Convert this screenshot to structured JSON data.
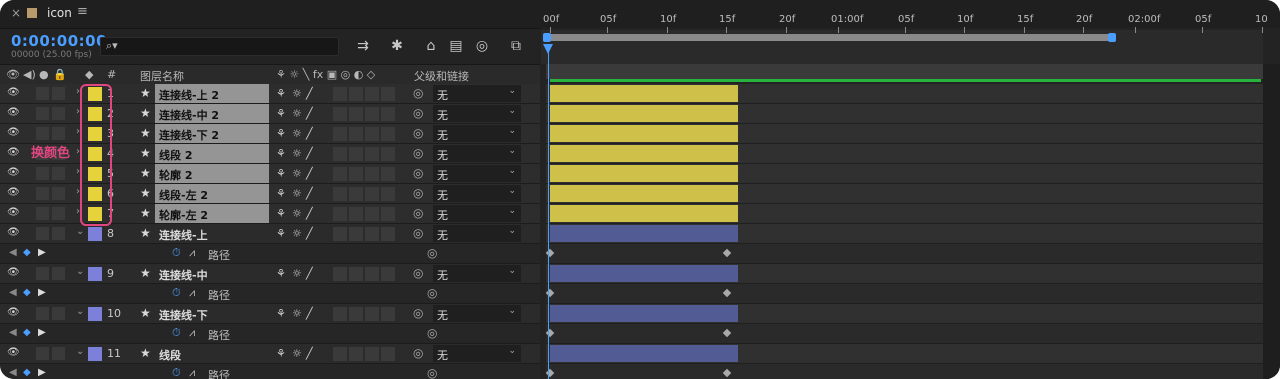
{
  "window": {
    "title": "icon"
  },
  "timecode": "0:00:00:00",
  "fps_text": "00000 (25.00 fps)",
  "search": {
    "placeholder": "",
    "icon": "search-icon"
  },
  "headers": {
    "hash": "#",
    "layer_name": "图层名称",
    "parent_link": "父级和链接"
  },
  "ruler_ticks": [
    "00f",
    "05f",
    "10f",
    "15f",
    "20f",
    "01:00f",
    "05f",
    "10f",
    "15f",
    "20f",
    "02:00f",
    "05f",
    "10"
  ],
  "layers": [
    {
      "num": "1",
      "name": "连接线-上 2",
      "parent": "无",
      "selected": true,
      "color": "#e6d33b"
    },
    {
      "num": "2",
      "name": "连接线-中 2",
      "parent": "无",
      "selected": true,
      "color": "#e6d33b"
    },
    {
      "num": "3",
      "name": "连接线-下 2",
      "parent": "无",
      "selected": true,
      "color": "#e6d33b"
    },
    {
      "num": "4",
      "name": "线段 2",
      "parent": "无",
      "selected": true,
      "color": "#e6d33b"
    },
    {
      "num": "5",
      "name": "轮廓 2",
      "parent": "无",
      "selected": true,
      "color": "#e6d33b"
    },
    {
      "num": "6",
      "name": "线段-左 2",
      "parent": "无",
      "selected": true,
      "color": "#e6d33b"
    },
    {
      "num": "7",
      "name": "轮廓-左 2",
      "parent": "无",
      "selected": true,
      "color": "#e6d33b"
    },
    {
      "num": "8",
      "name": "连接线-上",
      "parent": "无",
      "selected": false,
      "color": "#7c80d8",
      "prop": "路径"
    },
    {
      "num": "9",
      "name": "连接线-中",
      "parent": "无",
      "selected": false,
      "color": "#7c80d8",
      "prop": "路径"
    },
    {
      "num": "10",
      "name": "连接线-下",
      "parent": "无",
      "selected": false,
      "color": "#7c80d8",
      "prop": "路径"
    },
    {
      "num": "11",
      "name": "线段",
      "parent": "无",
      "selected": false,
      "color": "#7c80d8",
      "prop": "路径"
    }
  ],
  "annotation": {
    "text": "换颜色",
    "color": "#e0467f"
  },
  "colors": {
    "accent": "#4a9eff",
    "yellow_bar": "#cfc04a",
    "blue_bar": "#525b94",
    "work_area": "#27b33e"
  }
}
